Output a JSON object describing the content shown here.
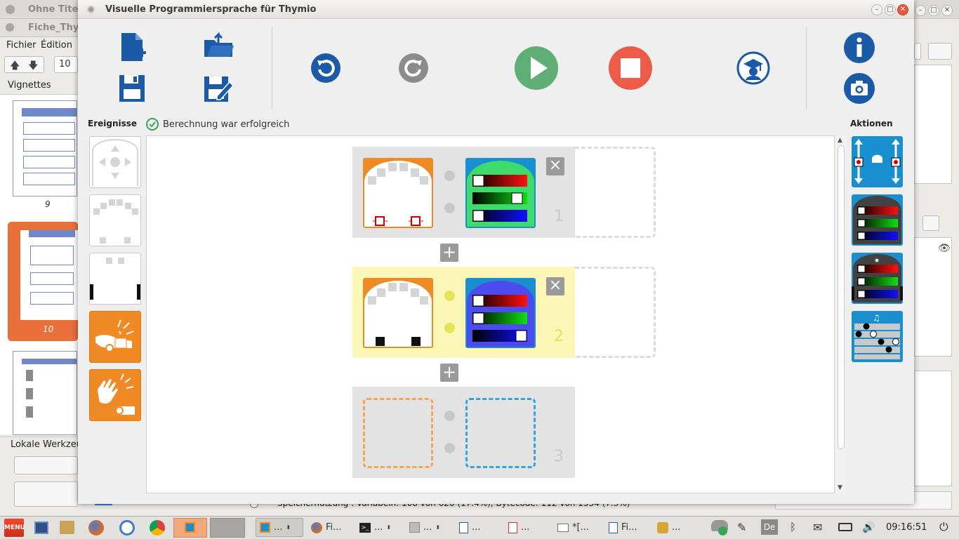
{
  "background_app": {
    "tabs": [
      "Ohne Titel",
      "Fiche_Thym"
    ],
    "menu": [
      "Fichier",
      "Édition"
    ],
    "zoom_value": "10",
    "thumbnails_title": "Vignettes",
    "page_numbers": [
      "9",
      "10"
    ],
    "local_tools_label": "Lokale Werkzeu",
    "status_text": "Speichernutzung : Variabeln: 108 von 620 (17.4%), Bytecode: 112 von 1534 (7.3%)"
  },
  "dialog": {
    "title": "Visuelle Programmiersprache für Thymio",
    "events_label": "Ereignisse",
    "status_message": "Berechnung war erfolgreich",
    "actions_label": "Aktionen",
    "rows": [
      {
        "number": "1",
        "state": "filled"
      },
      {
        "number": "2",
        "state": "selected"
      },
      {
        "number": "3",
        "state": "empty"
      }
    ]
  },
  "colors": {
    "orange": "#f08a24",
    "blue": "#1a8fd0",
    "play_green": "#5fae75",
    "stop_red": "#ec5b47",
    "selected_row": "#fbf8b7",
    "close_red": "#e85a3e"
  },
  "taskbar": {
    "menu_label": "MENU",
    "items": [
      "Fi...",
      "...",
      "...",
      "...",
      "...",
      "*[...",
      "Fi...",
      "..."
    ],
    "lang": "De",
    "clock": "09:16:51"
  }
}
